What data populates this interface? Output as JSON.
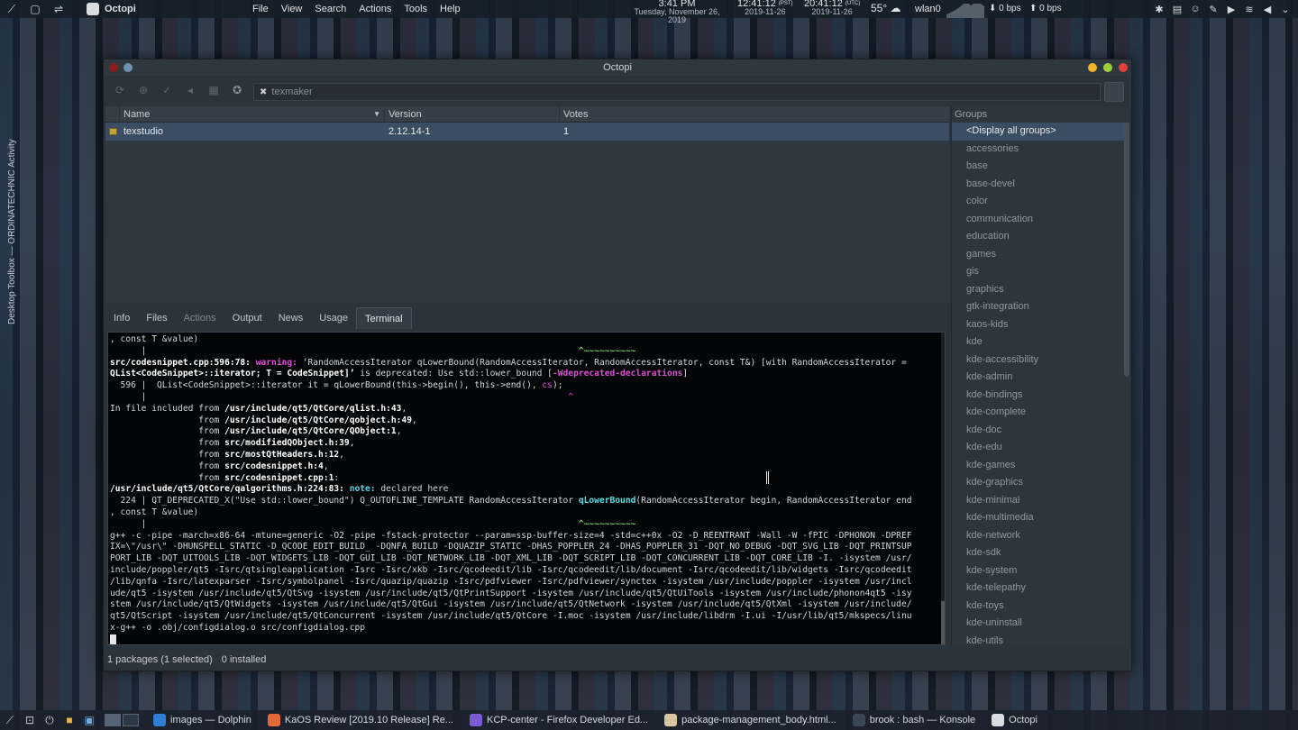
{
  "top_panel": {
    "app_name": "Octopi",
    "menu": [
      "File",
      "View",
      "Search",
      "Actions",
      "Tools",
      "Help"
    ],
    "clock_time": "3:41 PM",
    "clock_date": "Tuesday, November 26, 2019",
    "tz1_time": "12:41:12",
    "tz1_label": "(PST)",
    "tz1_date": "2019-11-26",
    "tz2_time": "20:41:12",
    "tz2_label": "(UTC)",
    "tz2_date": "2019-11-26",
    "weather": "55°",
    "net_iface": "wlan0",
    "down_rate": "⬇ 0 bps",
    "up_rate": "⬆ 0 bps"
  },
  "left_dock": {
    "label": "Desktop Toolbox — ORDINATECHNIC Activity"
  },
  "window": {
    "title": "Octopi",
    "search_value": "texmaker",
    "columns": {
      "name": "Name",
      "version": "Version",
      "votes": "Votes"
    },
    "packages": [
      {
        "name": "texstudio",
        "version": "2.12.14-1",
        "votes": "1"
      }
    ],
    "groups_header": "Groups",
    "groups": [
      "<Display all groups>",
      "accessories",
      "base",
      "base-devel",
      "color",
      "communication",
      "education",
      "games",
      "gis",
      "graphics",
      "gtk-integration",
      "kaos-kids",
      "kde",
      "kde-accessibility",
      "kde-admin",
      "kde-bindings",
      "kde-complete",
      "kde-doc",
      "kde-edu",
      "kde-games",
      "kde-graphics",
      "kde-minimal",
      "kde-multimedia",
      "kde-network",
      "kde-sdk",
      "kde-system",
      "kde-telepathy",
      "kde-toys",
      "kde-uninstall",
      "kde-utils"
    ],
    "tabs": [
      "Info",
      "Files",
      "Actions",
      "Output",
      "News",
      "Usage",
      "Terminal"
    ],
    "status": {
      "packages": "1 packages (1 selected)",
      "installed": "0 installed"
    }
  },
  "terminal": {
    "l01": ", const T &value)",
    "l02a": "      |                                                                                   ",
    "l02b": "^~~~~~~~~~~",
    "l03a": "src/codesnippet.cpp:596:78: ",
    "l03b": "warning: ",
    "l03c": "‘RandomAccessIterator qLowerBound(RandomAccessIterator, RandomAccessIterator, const T&) [with RandomAccessIterator =",
    "l04a": "QList<CodeSnippet>::iterator; T = CodeSnippet]’",
    "l04b": " is deprecated: Use std::lower_bound [",
    "l04c": "-Wdeprecated-declarations",
    "l04d": "]",
    "l05a": "  596 |  QList<CodeSnippet>::iterator it = qLowerBound(this->begin(), this->end(), ",
    "l05b": "cs",
    "l05c": ");",
    "l06a": "      |                                                                                 ",
    "l06b": "^",
    "l07a": "In file included from ",
    "l07b": "/usr/include/qt5/QtCore/qlist.h:43",
    "l07c": ",",
    "l08a": "                 from ",
    "l08b": "/usr/include/qt5/QtCore/qobject.h:49",
    "l08c": ",",
    "l09a": "                 from ",
    "l09b": "/usr/include/qt5/QtCore/QObject:1",
    "l09c": ",",
    "l10a": "                 from ",
    "l10b": "src/modifiedQObject.h:39",
    "l10c": ",",
    "l11a": "                 from ",
    "l11b": "src/mostQtHeaders.h:12",
    "l11c": ",",
    "l12a": "                 from ",
    "l12b": "src/codesnippet.h:4",
    "l12c": ",",
    "l13a": "                 from ",
    "l13b": "src/codesnippet.cpp:1",
    "l13c": ":",
    "l14a": "/usr/include/qt5/QtCore/qalgorithms.h:224:83: ",
    "l14b": "note: ",
    "l14c": "declared here",
    "l15a": "  224 | QT_DEPRECATED_X(\"Use std::lower_bound\") Q_OUTOFLINE_TEMPLATE RandomAccessIterator ",
    "l15b": "qLowerBound",
    "l15c": "(RandomAccessIterator begin, RandomAccessIterator end",
    "l16": ", const T &value)",
    "l17a": "      |                                                                                   ",
    "l17b": "^~~~~~~~~~~",
    "l18": "g++ -c -pipe -march=x86-64 -mtune=generic -O2 -pipe -fstack-protector --param=ssp-buffer-size=4 -std=c++0x -O2 -D_REENTRANT -Wall -W -fPIC -DPHONON -DPREF",
    "l19": "IX=\\\"/usr\\\" -DHUNSPELL_STATIC -D_QCODE_EDIT_BUILD_ -DQNFA_BUILD -DQUAZIP_STATIC -DHAS_POPPLER_24 -DHAS_POPPLER_31 -DQT_NO_DEBUG -DQT_SVG_LIB -DQT_PRINTSUP",
    "l20": "PORT_LIB -DQT_UITOOLS_LIB -DQT_WIDGETS_LIB -DQT_GUI_LIB -DQT_NETWORK_LIB -DQT_XML_LIB -DQT_SCRIPT_LIB -DQT_CONCURRENT_LIB -DQT_CORE_LIB -I. -isystem /usr/",
    "l21": "include/poppler/qt5 -Isrc/qtsingleapplication -Isrc -Isrc/xkb -Isrc/qcodeedit/lib -Isrc/qcodeedit/lib/document -Isrc/qcodeedit/lib/widgets -Isrc/qcodeedit",
    "l22": "/lib/qnfa -Isrc/latexparser -Isrc/symbolpanel -Isrc/quazip/quazip -Isrc/pdfviewer -Isrc/pdfviewer/synctex -isystem /usr/include/poppler -isystem /usr/incl",
    "l23": "ude/qt5 -isystem /usr/include/qt5/QtSvg -isystem /usr/include/qt5/QtPrintSupport -isystem /usr/include/qt5/QtUiTools -isystem /usr/include/phonon4qt5 -isy",
    "l24": "stem /usr/include/qt5/QtWidgets -isystem /usr/include/qt5/QtGui -isystem /usr/include/qt5/QtNetwork -isystem /usr/include/qt5/QtXml -isystem /usr/include/",
    "l25": "qt5/QtScript -isystem /usr/include/qt5/QtConcurrent -isystem /usr/include/qt5/QtCore -I.moc -isystem /usr/include/libdrm -I.ui -I/usr/lib/qt5/mkspecs/linu",
    "l26": "x-g++ -o .obj/configdialog.o src/configdialog.cpp"
  },
  "taskbar": {
    "tasks": [
      {
        "label": "images — Dolphin",
        "color": "#2d7fd4"
      },
      {
        "label": "KaOS Review [2019.10 Release] Re...",
        "color": "#e56a3a"
      },
      {
        "label": "KCP-center - Firefox Developer Ed...",
        "color": "#7a5cd6"
      },
      {
        "label": "package-management_body.html...",
        "color": "#d9c6a0"
      },
      {
        "label": "brook : bash — Konsole",
        "color": "#3b4654"
      },
      {
        "label": "Octopi",
        "color": "#d9dde2"
      }
    ]
  },
  "colors": {
    "selection": "#3b4d63",
    "terminal_bg": "#020406",
    "warning": "#e04bd7",
    "note": "#55d5ee"
  },
  "icons": [
    "menu-icon",
    "desktop-icon",
    "switch-icon",
    "search-icon",
    "close-icon",
    "lock-icon",
    "power-icon",
    "folder-icon"
  ]
}
